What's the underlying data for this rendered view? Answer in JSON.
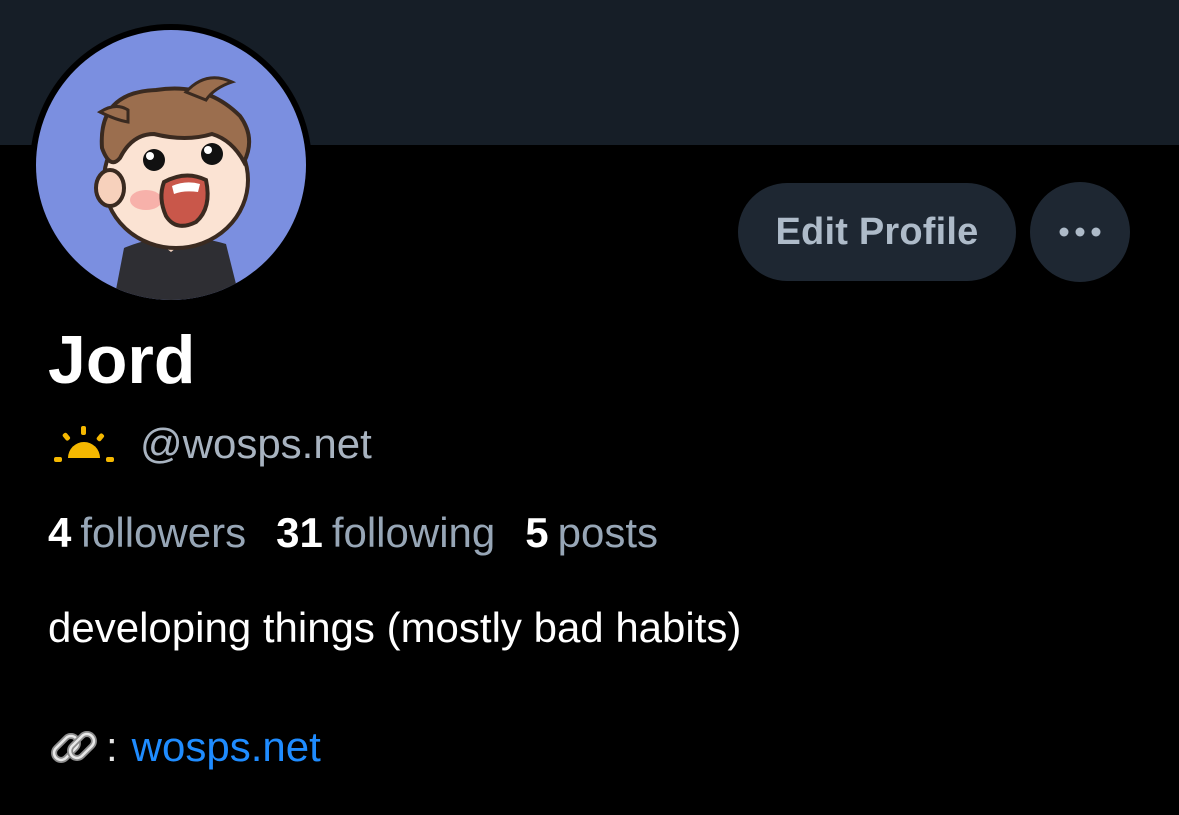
{
  "profile": {
    "display_name": "Jord",
    "handle": "@wosps.net",
    "handle_emoji": "sunrise-icon",
    "bio": "developing things (mostly bad habits)",
    "avatar": "cartoon-avatar"
  },
  "actions": {
    "edit_label": "Edit Profile",
    "more_icon": "ellipsis-icon"
  },
  "stats": {
    "followers_count": "4",
    "followers_label": "followers",
    "following_count": "31",
    "following_label": "following",
    "posts_count": "5",
    "posts_label": "posts"
  },
  "link": {
    "icon": "link-icon",
    "separator": ":",
    "text": "wosps.net"
  },
  "colors": {
    "background": "#000000",
    "banner": "#161e27",
    "button_bg": "#1e2732",
    "link": "#1f8cff",
    "avatar_bg": "#7b8fe0"
  }
}
